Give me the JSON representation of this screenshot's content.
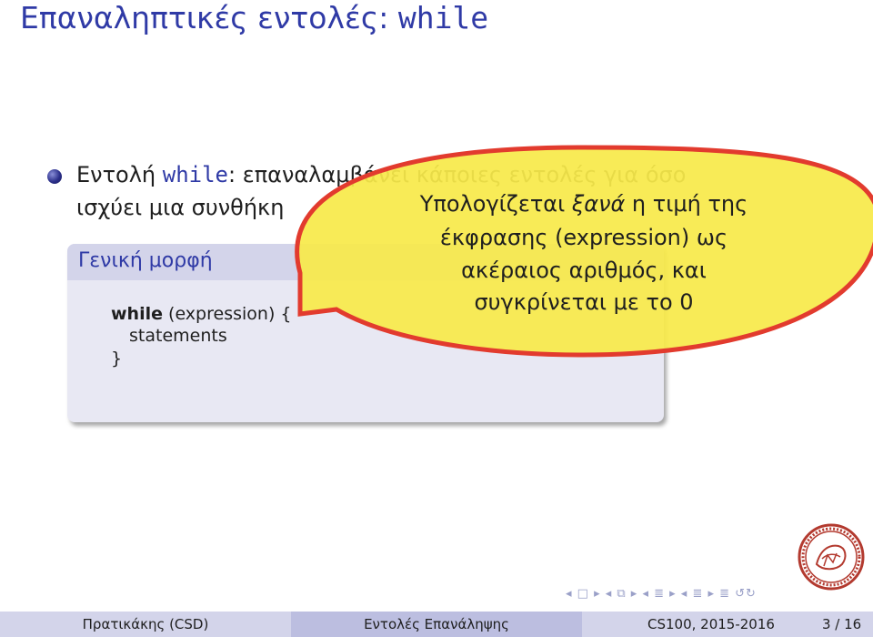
{
  "slide": {
    "title_prefix": "Επαναληπτικές εντολές: ",
    "title_code": "while"
  },
  "bullet": {
    "line1_prefix": "Εντολή ",
    "line1_code": "while",
    "line1_rest": ": επαναλαμβάνει κάποιες εντολές για όσο",
    "line2": "ισχύει μια συνθήκη"
  },
  "block": {
    "title": "Γενική μορφή",
    "code_keyword": "while",
    "code_line1_rest": " (expression) {",
    "code_line2": "statements",
    "code_line3": "}"
  },
  "callout": {
    "line1_prefix": "Υπολογίζεται ",
    "line1_emph": "ξανά",
    "line1_rest": " η τιμή της",
    "line2": "έκφρασης (expression) ως",
    "line3": "ακέραιος αριθμός, και",
    "line4": "συγκρίνεται με το 0",
    "fill_color": "#f7e94a",
    "stroke_color": "#e23b2e"
  },
  "footer": {
    "author": "Πρατικάκης (CSD)",
    "section": "Εντολές Επανάληψης",
    "course": "CS100, 2015-2016",
    "pages": "3 / 16"
  },
  "nav": {
    "symbols": "◂ □ ▸ ◂ ⧉ ▸ ◂ ≣ ▸ ◂ ≣ ▸ ≣ ↺↻"
  },
  "colors": {
    "accent": "#2f3aa6",
    "block_bg": "#e8e8f3",
    "block_head": "#d3d4ea"
  }
}
